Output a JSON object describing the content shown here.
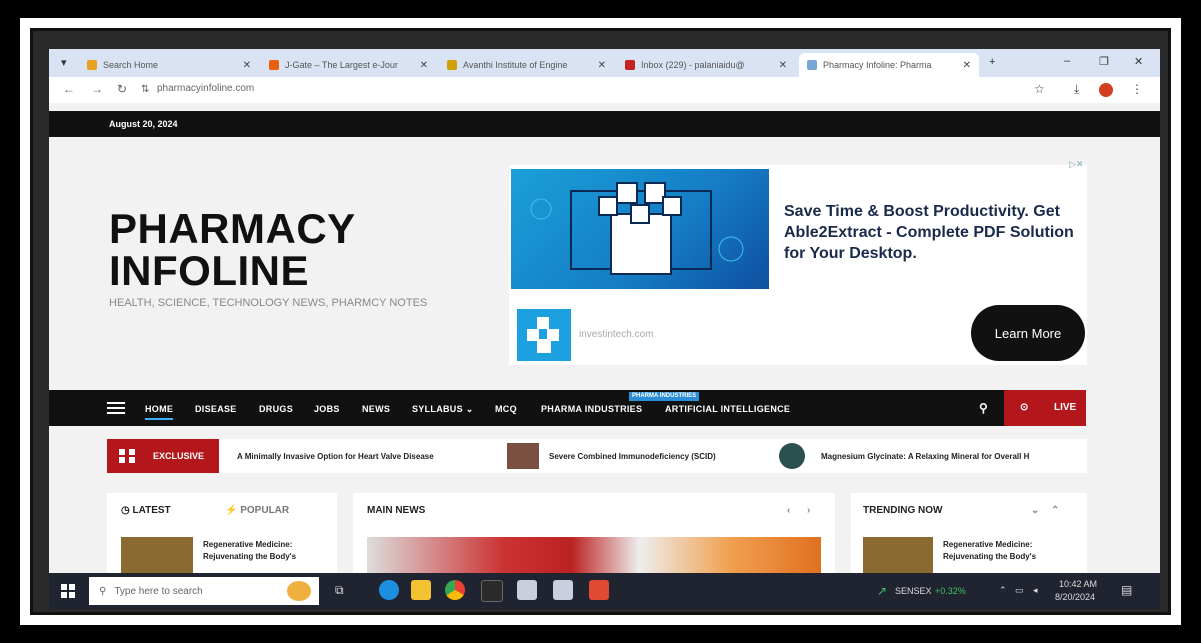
{
  "browser": {
    "tabs": [
      {
        "label": "Search Home",
        "favicon_color": "#e8a020"
      },
      {
        "label": "J-Gate – The Largest e-Jour",
        "favicon_color": "#e86010"
      },
      {
        "label": "Avanthi Institute of Engine",
        "favicon_color": "#d0a000"
      },
      {
        "label": "Inbox (229) - palaniaidu@",
        "favicon_color": "#c5221f"
      },
      {
        "label": "Pharmacy Infoline: Pharma",
        "favicon_color": "#7aa6d6"
      }
    ],
    "new_tab": "+",
    "url": "pharmacyinfoline.com",
    "url_lock_glyph": "⇅"
  },
  "site": {
    "date": "August 20, 2024",
    "logo_line1": "PHARMACY",
    "logo_line2": "INFOLINE",
    "tagline": "HEALTH, SCIENCE, TECHNOLOGY NEWS, PHARMCY NOTES",
    "ad": {
      "headline": "Save Time & Boost Productivity. Get Able2Extract - Complete PDF Solution for Your Desktop.",
      "domain": "investintech.com",
      "cta": "Learn More"
    },
    "nav": {
      "items": [
        "HOME",
        "DISEASE",
        "DRUGS",
        "JOBS",
        "NEWS",
        "SYLLABUS ⌄",
        "MCQ",
        "PHARMA INDUSTRIES",
        "ARTIFICIAL INTELLIGENCE"
      ],
      "badge": "PHARMA INDUSTRIES",
      "live_label": "LIVE"
    },
    "ticker": {
      "label": "EXCLUSIVE",
      "items": [
        "A Minimally Invasive Option for Heart Valve Disease",
        "Severe Combined Immunodeficiency (SCID)",
        "Magnesium Glycinate: A Relaxing Mineral for Overall H"
      ]
    },
    "panels": {
      "latest_label": "LATEST",
      "popular_label": "POPULAR",
      "main_news_label": "MAIN NEWS",
      "trending_label": "TRENDING NOW",
      "latest_article": "Regenerative Medicine: Rejuvenating the Body's",
      "trending_article": "Regenerative Medicine: Rejuvenating the Body's"
    }
  },
  "taskbar": {
    "search_placeholder": "Type here to search",
    "stock_label": "SENSEX",
    "stock_change": "+0.32%",
    "time": "10:42 AM",
    "date": "8/20/2024"
  }
}
